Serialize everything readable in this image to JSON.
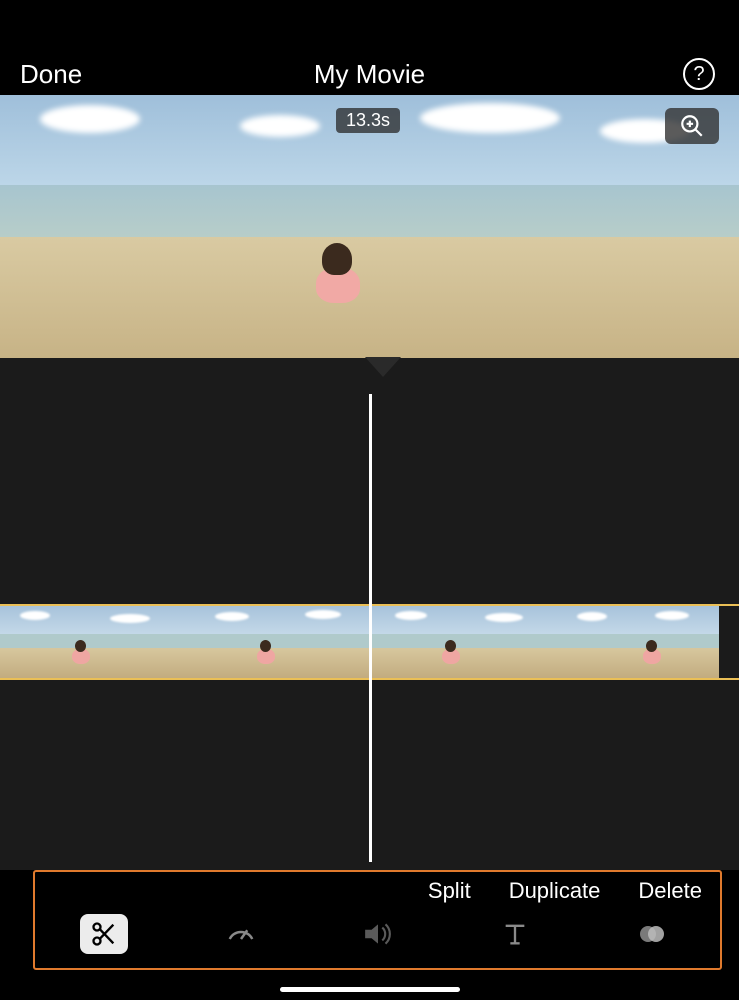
{
  "header": {
    "done": "Done",
    "title": "My Movie"
  },
  "preview": {
    "duration": "13.3s"
  },
  "edit": {
    "split": "Split",
    "duplicate": "Duplicate",
    "delete": "Delete"
  }
}
